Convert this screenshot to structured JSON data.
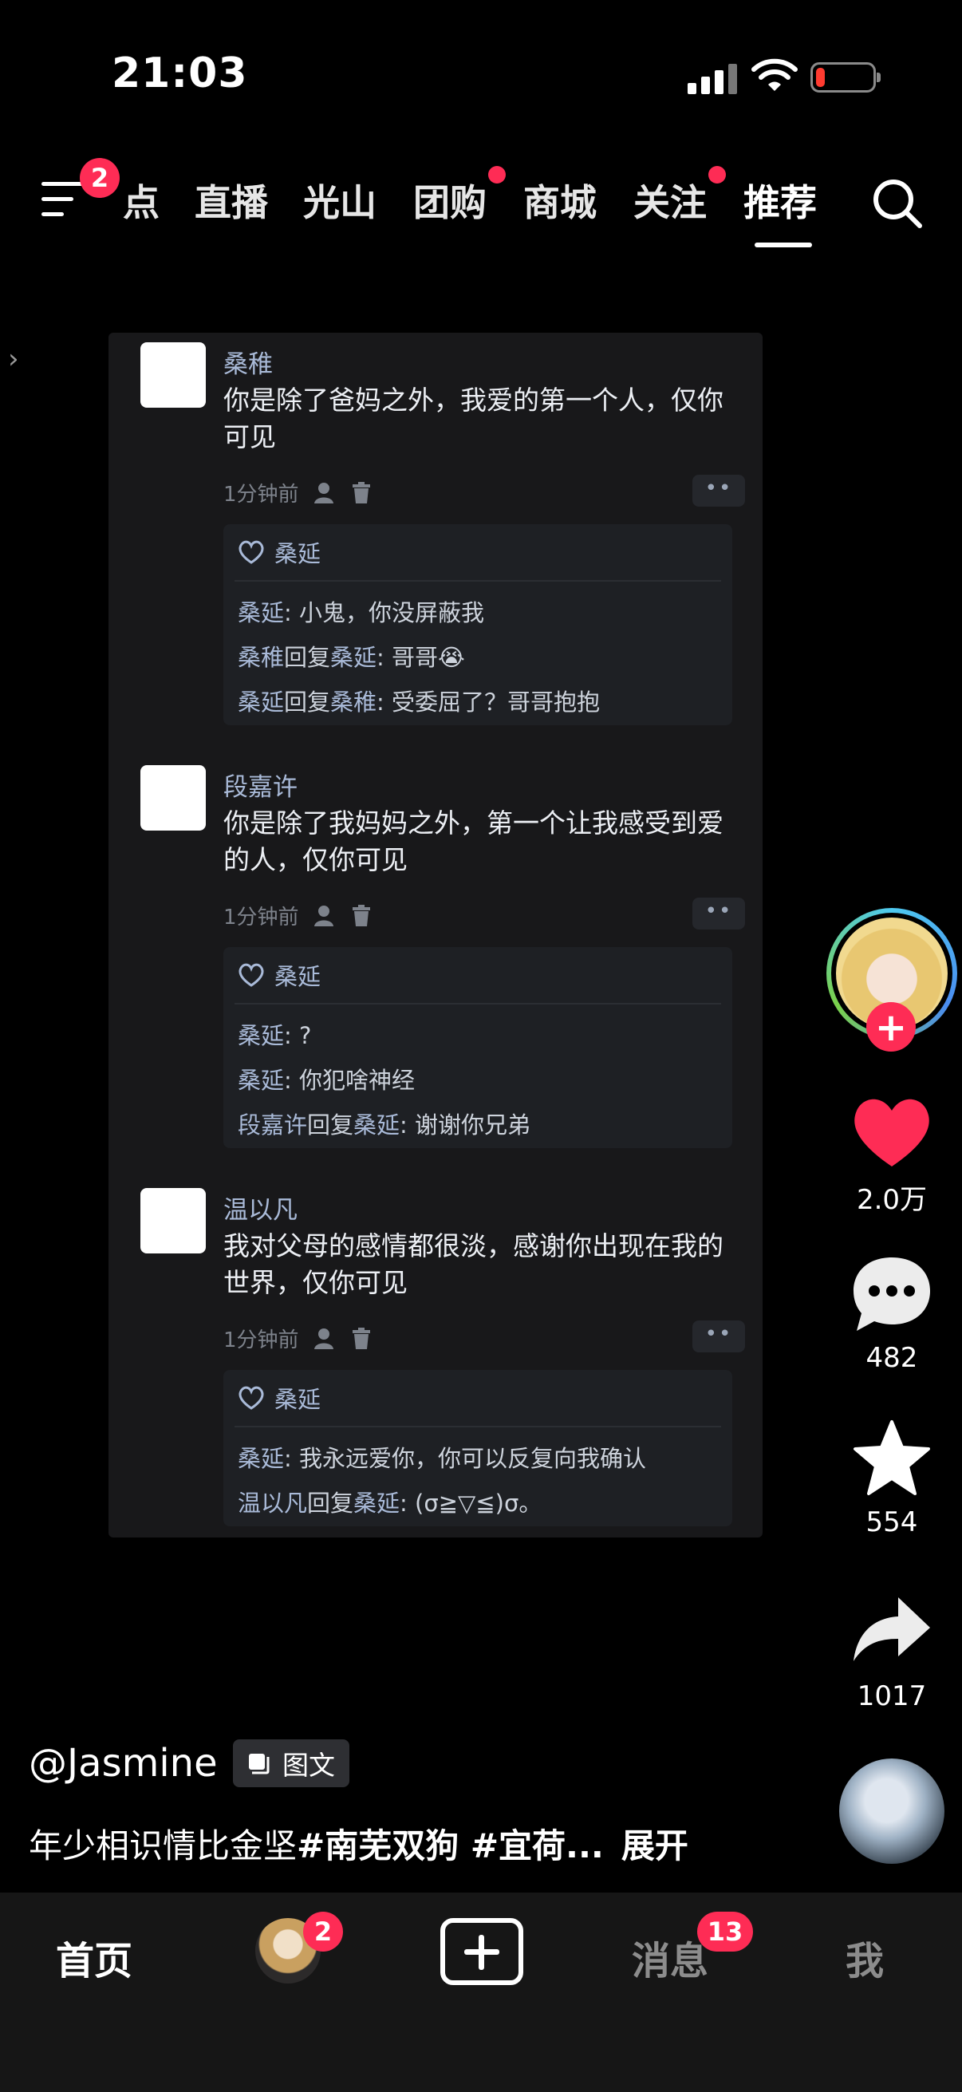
{
  "status_bar": {
    "time": "21:03"
  },
  "top_nav": {
    "menu_badge": "2",
    "tabs": [
      "点",
      "直播",
      "光山",
      "团购",
      "商城",
      "关注",
      "推荐"
    ],
    "active_tab": "推荐"
  },
  "comments": [
    {
      "name": "桑稚",
      "text": "你是除了爸妈之外，我爱的第一个人，仅你可见",
      "time": "1分钟前",
      "more": "••",
      "liked_by": "桑延",
      "replies": [
        {
          "from": "桑延",
          "connector": "",
          "to": "",
          "text": ": 小鬼，你没屏蔽我"
        },
        {
          "from": "桑稚",
          "connector": "回复",
          "to": "桑延",
          "text": ": 哥哥😭"
        },
        {
          "from": "桑延",
          "connector": "回复",
          "to": "桑稚",
          "text": ": 受委屈了？哥哥抱抱"
        }
      ]
    },
    {
      "name": "段嘉许",
      "text": "你是除了我妈妈之外，第一个让我感受到爱的人，仅你可见",
      "time": "1分钟前",
      "more": "••",
      "liked_by": "桑延",
      "replies": [
        {
          "from": "桑延",
          "connector": "",
          "to": "",
          "text": ": ?"
        },
        {
          "from": "桑延",
          "connector": "",
          "to": "",
          "text": ": 你犯啥神经"
        },
        {
          "from": "段嘉许",
          "connector": "回复",
          "to": "桑延",
          "text": ": 谢谢你兄弟"
        }
      ]
    },
    {
      "name": "温以凡",
      "text": "我对父母的感情都很淡，感谢你出现在我的世界，仅你可见",
      "time": "1分钟前",
      "more": "••",
      "liked_by": "桑延",
      "replies": [
        {
          "from": "桑延",
          "connector": "",
          "to": "",
          "text": ": 我永远爱你，你可以反复向我确认"
        },
        {
          "from": "温以凡",
          "connector": "回复",
          "to": "桑延",
          "text": ": (σ≧▽≦)σ。"
        }
      ]
    }
  ],
  "rail": {
    "follow": "+",
    "likes": "2.0万",
    "comments": "482",
    "favorites": "554",
    "shares": "1017",
    "like_color": "#fe2c55"
  },
  "post": {
    "author": "@Jasmine",
    "type_tag": "图文",
    "caption_plain": "年少相识情比金坚",
    "caption_tags": "#南芜双狗 #宜荷...",
    "expand": "展开"
  },
  "bottom_bar": {
    "home": "首页",
    "friends_badge": "2",
    "messages": "消息",
    "messages_badge": "13",
    "me": "我"
  }
}
